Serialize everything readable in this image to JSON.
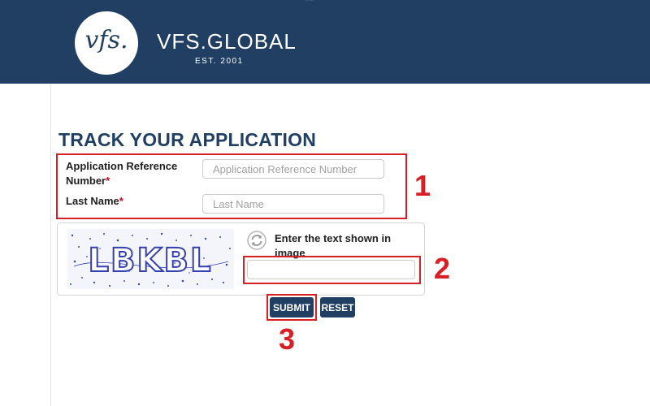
{
  "header": {
    "logo_mark": "vfs.",
    "brand_name": "VFS.GLOBAL",
    "established": "EST. 2001",
    "top_fragment": "== "
  },
  "page": {
    "title": "TRACK YOUR APPLICATION"
  },
  "form": {
    "reference_label_line1": "Application Reference",
    "reference_label_line2": "Number",
    "required_marker": "*",
    "reference_placeholder": "Application Reference Number",
    "reference_value": "",
    "lastname_label": "Last Name",
    "lastname_placeholder": "Last Name",
    "lastname_value": ""
  },
  "captcha": {
    "text": "LBKBL",
    "prompt": "Enter the text shown in image",
    "value": "",
    "icon": "refresh-icon"
  },
  "buttons": {
    "submit": "SUBMIT",
    "reset": "RESET"
  },
  "annotations": {
    "one": "1",
    "two": "2",
    "three": "3"
  },
  "colors": {
    "brand": "#213f63",
    "highlight": "#d81f26",
    "required": "#d0021b"
  }
}
